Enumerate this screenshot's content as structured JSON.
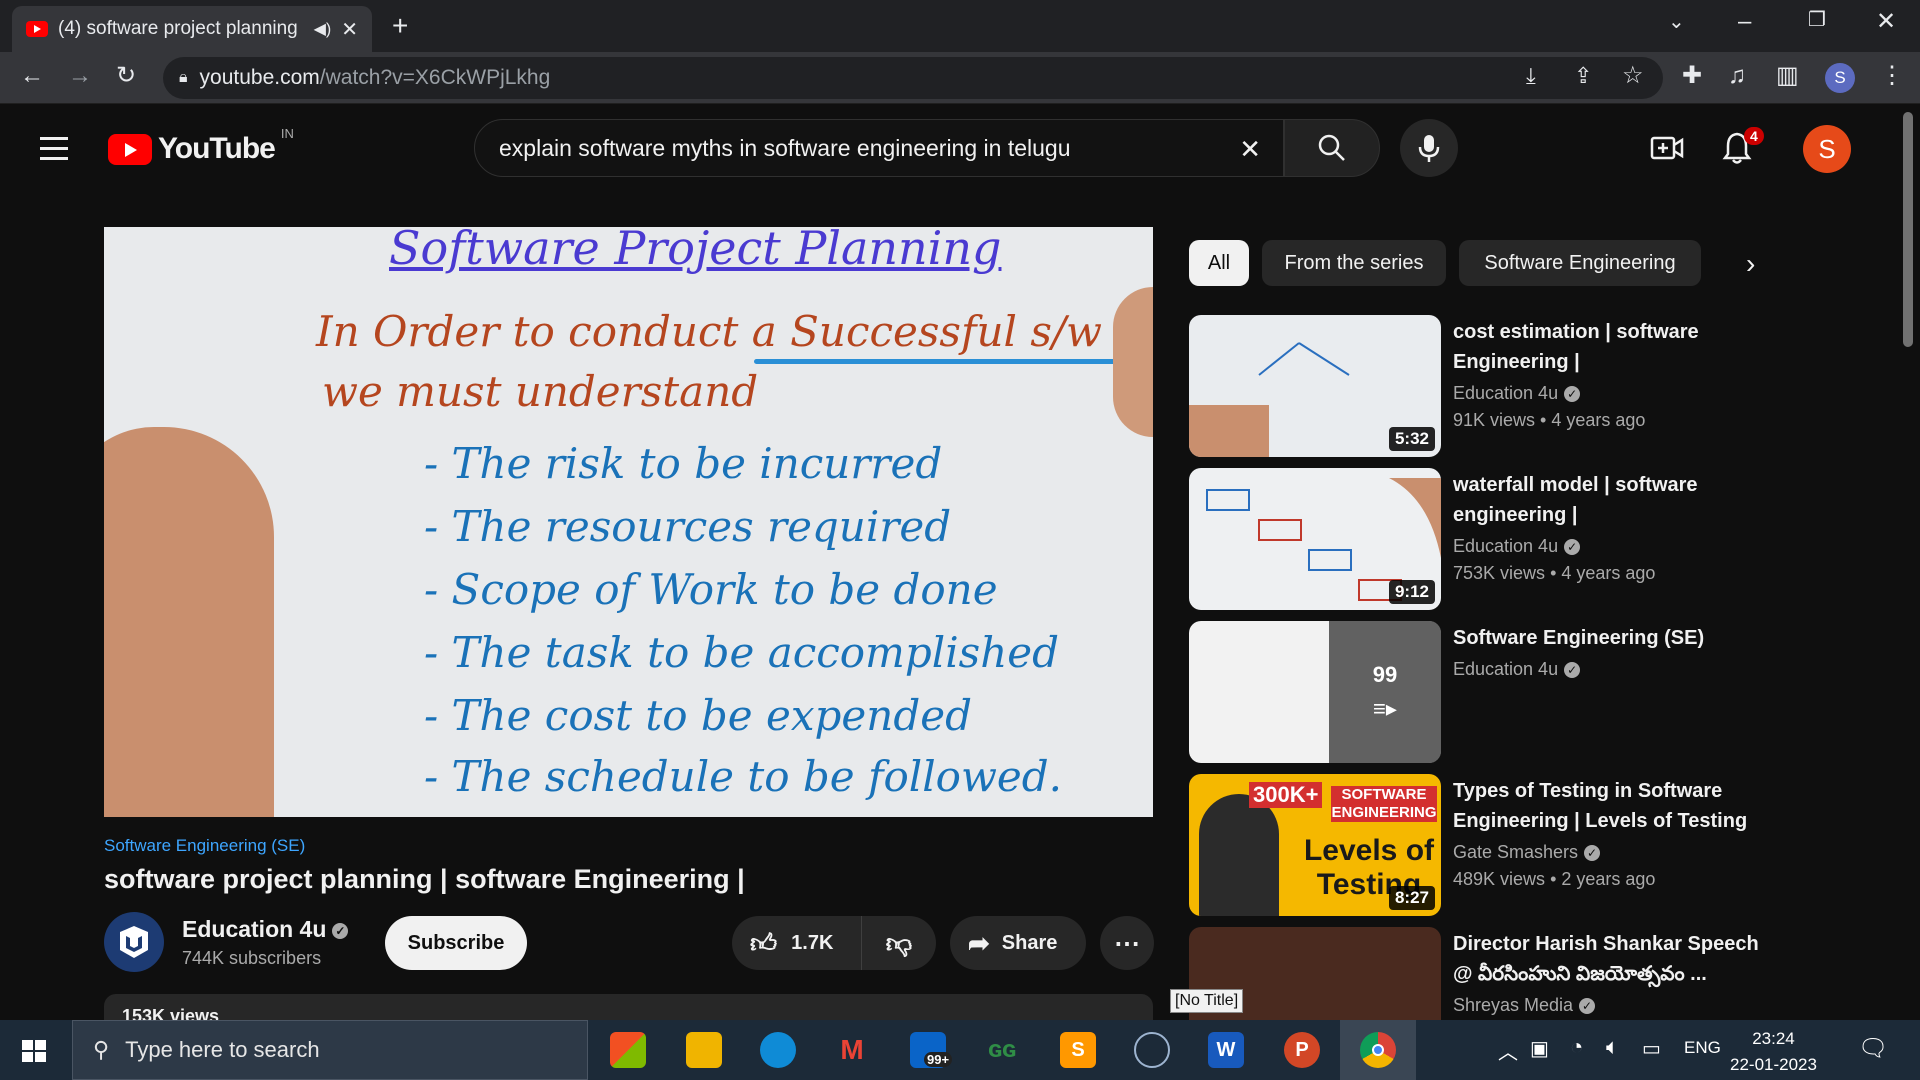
{
  "browser": {
    "tab_title": "(4) software project planning",
    "url_host": "youtube.com",
    "url_path": "/watch?v=X6CkWPjLkhg",
    "profile_initial": "S"
  },
  "youtube": {
    "logo_text": "YouTube",
    "region": "IN",
    "search_query": "explain software myths in software engineering in telugu",
    "notification_count": "4",
    "avatar_initial": "S"
  },
  "whiteboard": {
    "heading": "Software Project Planning",
    "line1": "In Order to conduct a Successful s/w project,",
    "line2": "we must understand",
    "items": [
      "- The risk to be incurred",
      "- The resources required",
      "- Scope of Work to be done",
      "- The task to be accomplished",
      "- The cost to be expended",
      "- The schedule to be followed."
    ]
  },
  "video": {
    "series": "Software Engineering (SE)",
    "title": "software project planning | software Engineering |",
    "channel": "Education 4u",
    "subscribers": "744K subscribers",
    "subscribe_label": "Subscribe",
    "likes": "1.7K",
    "share_label": "Share",
    "description_peek": "153K views"
  },
  "chips": [
    "All",
    "From the series",
    "Software Engineering"
  ],
  "recommendations": [
    {
      "title": "cost estimation | software Engineering |",
      "channel": "Education 4u",
      "views": "91K views",
      "age": "4 years ago",
      "duration": "5:32"
    },
    {
      "title": "waterfall model | software engineering |",
      "channel": "Education 4u",
      "views": "753K views",
      "age": "4 years ago",
      "duration": "9:12"
    },
    {
      "title": "Software Engineering (SE)",
      "channel": "Education 4u",
      "playlist_count": "99"
    },
    {
      "title": "Types of Testing in Software Engineering | Levels of Testing",
      "channel": "Gate Smashers",
      "views": "489K views",
      "age": "2 years ago",
      "duration": "8:27",
      "thumb_badge": "300K+",
      "thumb_tag": "SOFTWARE ENGINEERING",
      "thumb_text": "Levels of Testing"
    },
    {
      "title": "Director Harish Shankar Speech @ వీరసింహుని విజయోత్సవం ...",
      "channel": "Shreyas Media"
    }
  ],
  "tooltip": "[No Title]",
  "taskbar": {
    "search_placeholder": "Type here to search",
    "mail_badge": "99+",
    "language": "ENG",
    "time": "23:24",
    "date": "22-01-2023"
  }
}
